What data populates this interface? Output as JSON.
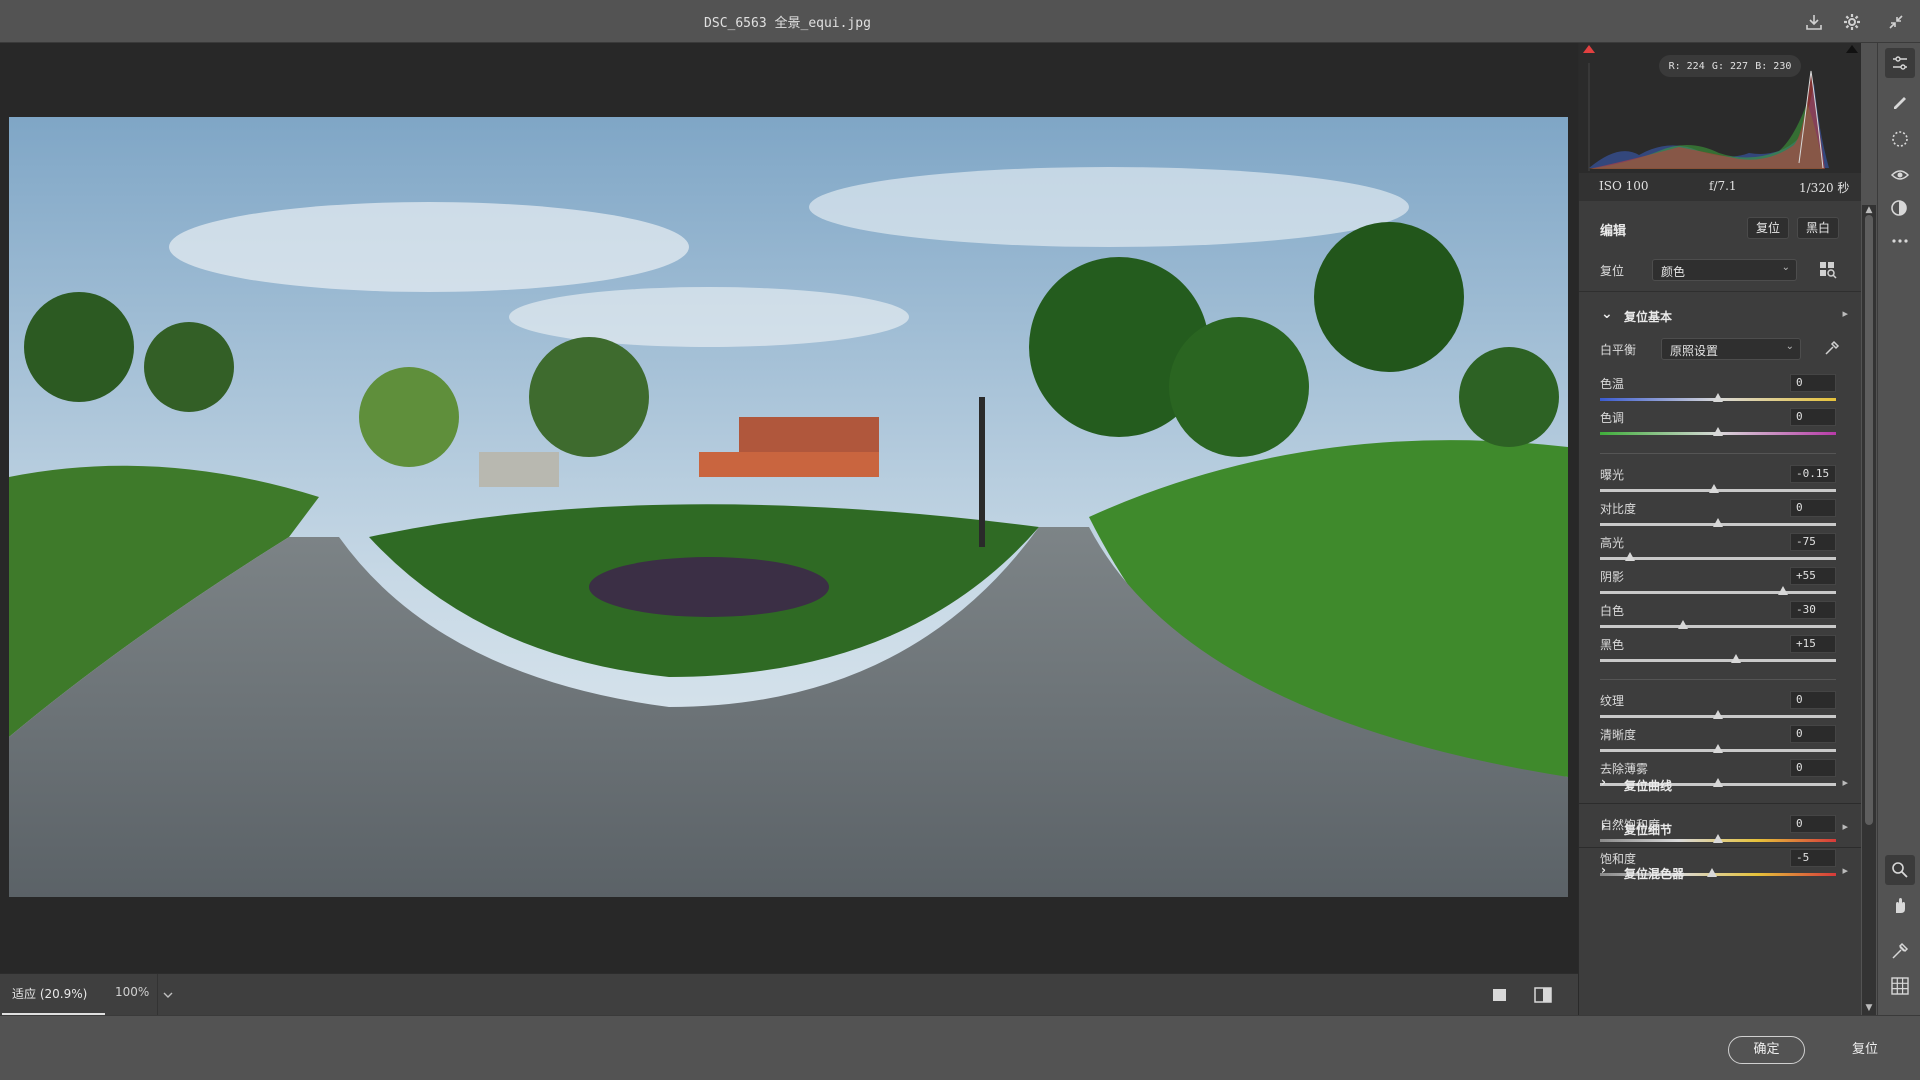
{
  "window": {
    "title": "DSC_6563 全景_equi.jpg"
  },
  "histogram": {
    "r": "R: 224",
    "g": "G: 227",
    "b": "B: 230"
  },
  "exif": {
    "iso": "ISO 100",
    "aperture": "f/7.1",
    "shutter": "1/320 秒"
  },
  "edit": {
    "title": "编辑",
    "reset_btn": "复位",
    "bw_btn": "黑白"
  },
  "profile": {
    "label": "复位",
    "value": "颜色"
  },
  "basic": {
    "title": "复位基本",
    "wb_label": "白平衡",
    "wb_value": "原照设置",
    "sliders": [
      {
        "name": "色温",
        "value": "0",
        "pos": 0.5
      },
      {
        "name": "色调",
        "value": "0",
        "pos": 0.5
      },
      {
        "name": "曝光",
        "value": "-0.15",
        "pos": 0.485
      },
      {
        "name": "对比度",
        "value": "0",
        "pos": 0.5
      },
      {
        "name": "高光",
        "value": "-75",
        "pos": 0.125
      },
      {
        "name": "阴影",
        "value": "+55",
        "pos": 0.775
      },
      {
        "name": "白色",
        "value": "-30",
        "pos": 0.35
      },
      {
        "name": "黑色",
        "value": "+15",
        "pos": 0.575
      },
      {
        "name": "纹理",
        "value": "0",
        "pos": 0.5
      },
      {
        "name": "清晰度",
        "value": "0",
        "pos": 0.5
      },
      {
        "name": "去除薄雾",
        "value": "0",
        "pos": 0.5
      },
      {
        "name": "自然饱和度",
        "value": "0",
        "pos": 0.5
      },
      {
        "name": "饱和度",
        "value": "-5",
        "pos": 0.475
      }
    ]
  },
  "groups": {
    "curve": "复位曲线",
    "detail": "复位细节",
    "mixer": "复位混色器"
  },
  "zoom": {
    "fit": "适应 (20.9%)",
    "full": "100%"
  },
  "footer": {
    "ok": "确定",
    "reset": "复位"
  },
  "colors": {
    "panel": "#3d3d3d",
    "canvas": "#282828",
    "chrome": "#535353"
  }
}
